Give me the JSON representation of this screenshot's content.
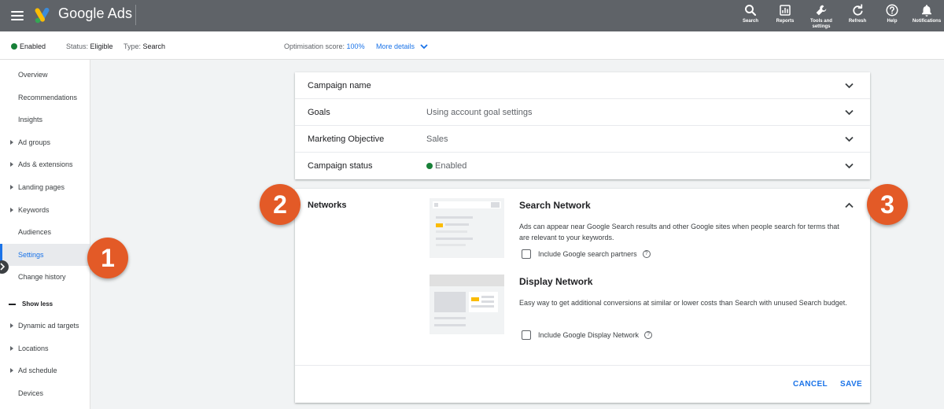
{
  "app": {
    "title": "Google Ads",
    "actions": [
      {
        "label": "Search",
        "icon": "search-icon"
      },
      {
        "label": "Reports",
        "icon": "reports-icon"
      },
      {
        "label": "Tools and settings",
        "icon": "wrench-icon"
      },
      {
        "label": "Refresh",
        "icon": "refresh-icon"
      },
      {
        "label": "Help",
        "icon": "help-icon"
      },
      {
        "label": "Notifications",
        "icon": "bell-icon"
      }
    ]
  },
  "status": {
    "enabled": "Enabled",
    "status_key": "Status:",
    "status_value": "Eligible",
    "type_key": "Type:",
    "type_value": "Search",
    "opt_key": "Optimisation score:",
    "opt_value": "100%",
    "more_details": "More details"
  },
  "sidebar": {
    "items": [
      {
        "label": "Overview",
        "caret": false
      },
      {
        "label": "Recommendations",
        "caret": false
      },
      {
        "label": "Insights",
        "caret": false
      },
      {
        "label": "Ad groups",
        "caret": true
      },
      {
        "label": "Ads & extensions",
        "caret": true
      },
      {
        "label": "Landing pages",
        "caret": true
      },
      {
        "label": "Keywords",
        "caret": true
      },
      {
        "label": "Audiences",
        "caret": false
      },
      {
        "label": "Settings",
        "caret": false,
        "active": true
      },
      {
        "label": "Change history",
        "caret": false
      }
    ],
    "show_less": "Show less",
    "more_items": [
      {
        "label": "Dynamic ad targets",
        "caret": true
      },
      {
        "label": "Locations",
        "caret": true
      },
      {
        "label": "Ad schedule",
        "caret": true
      },
      {
        "label": "Devices",
        "caret": false
      }
    ]
  },
  "settings": {
    "rows": [
      {
        "label": "Campaign name",
        "value": ""
      },
      {
        "label": "Goals",
        "value": "Using account goal settings"
      },
      {
        "label": "Marketing Objective",
        "value": "Sales"
      },
      {
        "label": "Campaign status",
        "value": "Enabled"
      }
    ]
  },
  "networks": {
    "title": "Networks",
    "search": {
      "title": "Search Network",
      "description": "Ads can appear near Google Search results and other Google sites when people search for terms that are relevant to your keywords.",
      "checkbox": "Include Google search partners"
    },
    "display": {
      "title": "Display Network",
      "description": "Easy way to get additional conversions at similar or lower costs than Search with unused Search budget.",
      "checkbox": "Include Google Display Network"
    },
    "cancel": "CANCEL",
    "save": "SAVE"
  },
  "callouts": [
    "1",
    "2",
    "3"
  ],
  "colors": {
    "accent": "#1a73e8",
    "callout": "#e35a27",
    "enabled": "#188038"
  }
}
